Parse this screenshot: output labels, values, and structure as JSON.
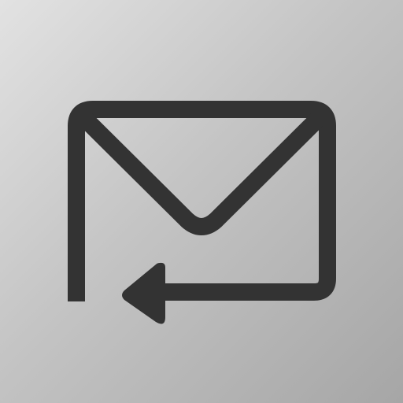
{
  "icon": {
    "name": "mail-reply-icon",
    "colors": {
      "background_light": "#e2e2e2",
      "background_dark": "#a6a6a6",
      "stroke": "#333333"
    }
  }
}
